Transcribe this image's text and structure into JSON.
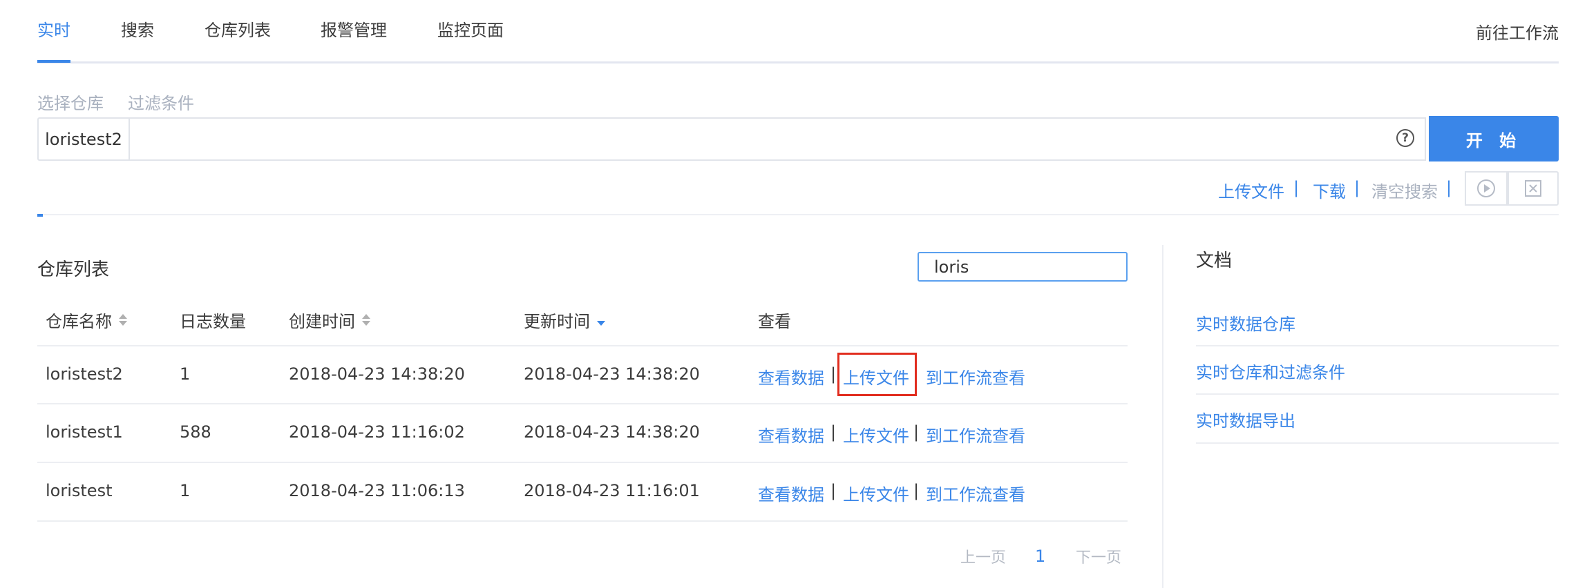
{
  "nav": {
    "tabs": [
      {
        "label": "实时",
        "active": true
      },
      {
        "label": "搜索",
        "active": false
      },
      {
        "label": "仓库列表",
        "active": false
      },
      {
        "label": "报警管理",
        "active": false
      },
      {
        "label": "监控页面",
        "active": false
      }
    ],
    "goto_workflow": "前往工作流"
  },
  "filters": {
    "select_repo": "选择仓库",
    "filter_conditions": "过滤条件"
  },
  "search": {
    "repo_tag": "loristest2",
    "query": "",
    "help_icon": "question-circle-icon",
    "start_label": "开 始"
  },
  "actions": {
    "upload": "上传文件",
    "download": "下载",
    "clear": "清空搜索",
    "separator": "|",
    "play_icon": "play-circle-icon",
    "stop_icon": "close-square-icon"
  },
  "repo_list": {
    "title": "仓库列表",
    "filter_value": "loris",
    "columns": [
      "仓库名称",
      "日志数量",
      "创建时间",
      "更新时间",
      "查看"
    ],
    "rows": [
      {
        "name": "loristest2",
        "count": "1",
        "created": "2018-04-23 14:38:20",
        "updated": "2018-04-23 14:38:20"
      },
      {
        "name": "loristest1",
        "count": "588",
        "created": "2018-04-23 11:16:02",
        "updated": "2018-04-23 14:38:20"
      },
      {
        "name": "loristest",
        "count": "1",
        "created": "2018-04-23 11:06:13",
        "updated": "2018-04-23 11:16:01"
      }
    ],
    "row_actions": {
      "view": "查看数据",
      "upload": "上传文件",
      "workflow": "到工作流查看",
      "sep": "|"
    },
    "pagination": {
      "prev": "上一页",
      "current": "1",
      "next": "下一页"
    }
  },
  "docs": {
    "title": "文档",
    "links": [
      "实时数据仓库",
      "实时仓库和过滤条件",
      "实时数据导出"
    ]
  },
  "colors": {
    "accent": "#3a86e8",
    "highlight": "#e12d1f"
  }
}
